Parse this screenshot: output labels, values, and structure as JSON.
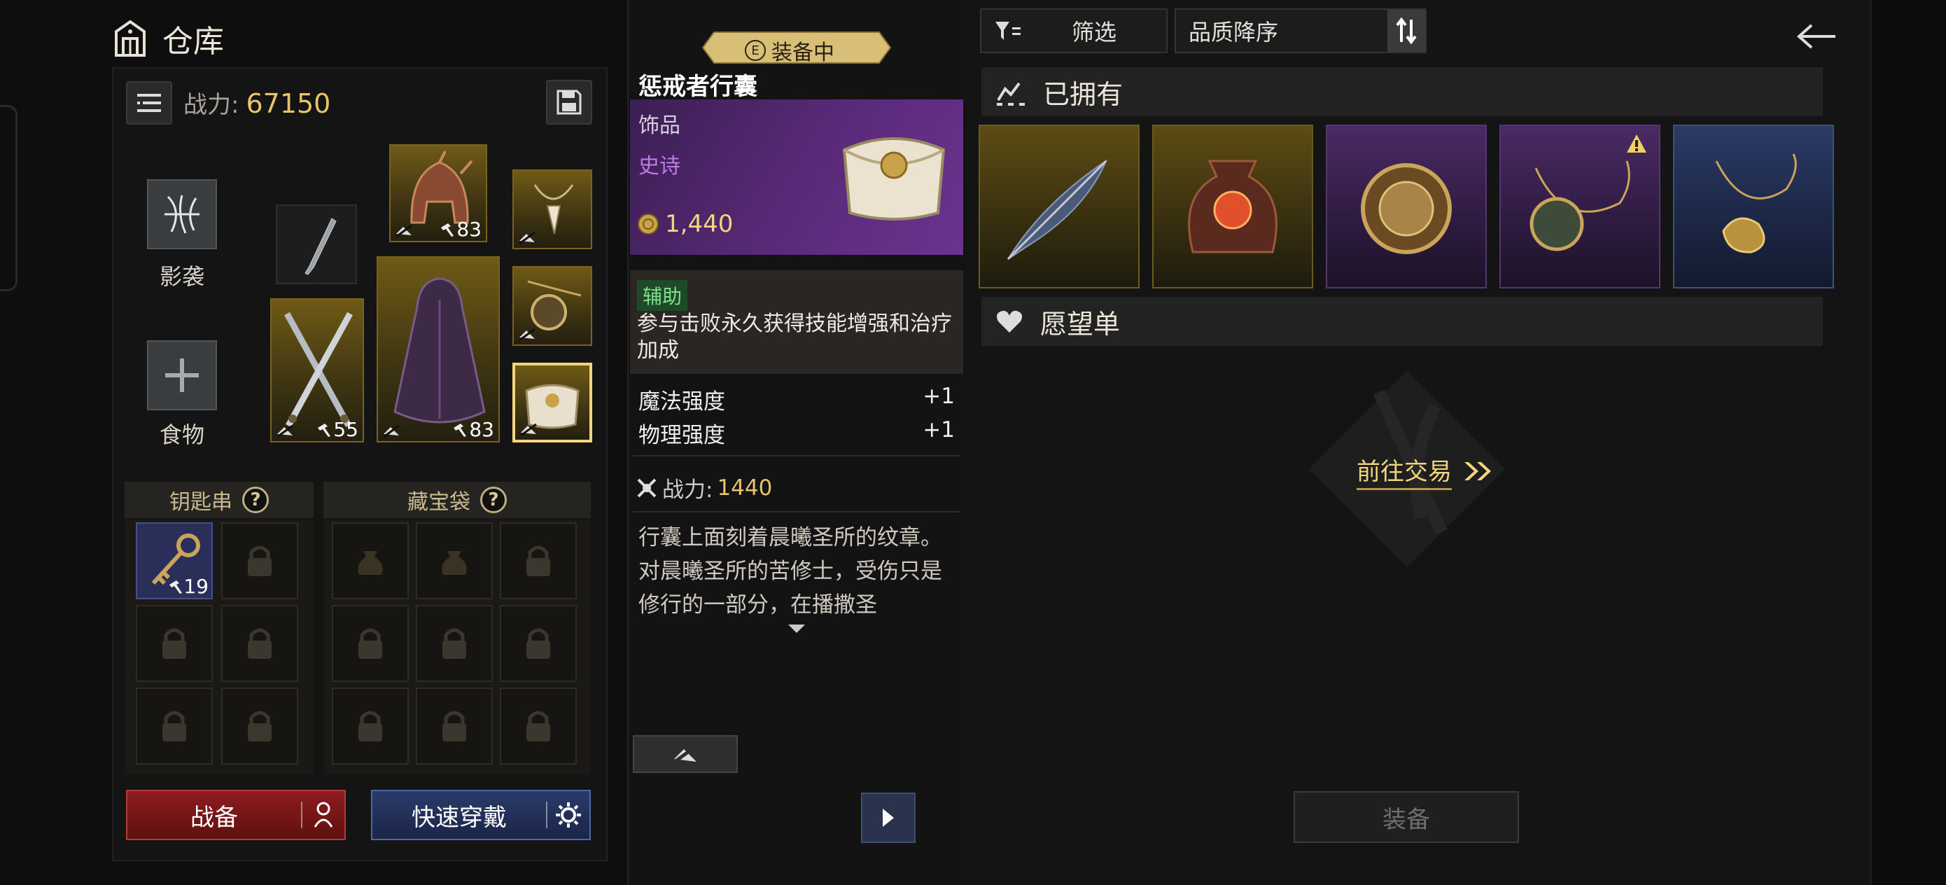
{
  "warehouse": {
    "title": "仓库",
    "power_label": "战力:",
    "power_value": "67150",
    "side_slots": [
      {
        "label": "影袭"
      },
      {
        "label": "食物"
      }
    ],
    "equipment": {
      "helmet_level": "83",
      "weapon_level": "55",
      "cloak_level": "83"
    },
    "keyring": {
      "title": "钥匙串",
      "key_count": "19"
    },
    "treasure_bag": {
      "title": "藏宝袋"
    },
    "battle_button": "战备",
    "quick_wear_button": "快速穿戴"
  },
  "detail": {
    "badge": "装备中",
    "name": "惩戒者行囊",
    "type": "饰品",
    "rarity": "史诗",
    "price": "1,440",
    "skill_tag": "辅助",
    "skill_desc": "参与击败永久获得技能增强和治疗加成",
    "stats": [
      {
        "name": "魔法强度",
        "value": "+1"
      },
      {
        "name": "物理强度",
        "value": "+1"
      }
    ],
    "power_label": "战力:",
    "power_value": "1440",
    "lore": "行囊上面刻着晨曦圣所的纹章。对晨曦圣所的苦修士，受伤只是修行的一部分，在播撒圣"
  },
  "collection": {
    "filter_label": "筛选",
    "sort_label": "品质降序",
    "owned_title": "已拥有",
    "owned_items": [
      {
        "name": "feather",
        "rarity": "gold"
      },
      {
        "name": "red-pouch",
        "rarity": "gold"
      },
      {
        "name": "lion-ring",
        "rarity": "purple"
      },
      {
        "name": "medallion-necklace",
        "rarity": "purple",
        "warning": true
      },
      {
        "name": "gold-necklace",
        "rarity": "blue"
      }
    ],
    "wishlist_title": "愿望单",
    "trade_link": "前往交易",
    "equip_button": "装备"
  },
  "colors": {
    "gold_text": "#e8c36a",
    "epic_purple": "#c07be6",
    "battle_red": "#8e1d1d",
    "quick_blue": "#2b3a6a"
  }
}
